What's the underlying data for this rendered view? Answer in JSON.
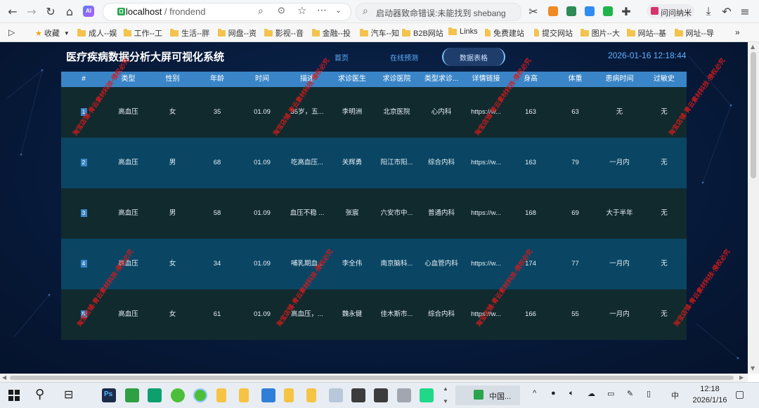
{
  "browser": {
    "address_host": "localhost",
    "address_path": " / frondend",
    "search_text": "启动器致命错误:未能找到 shebang",
    "profile_label": "问问纳米"
  },
  "bookmarks": [
    {
      "label": "收藏",
      "type": "star"
    },
    {
      "label": "成人--娱",
      "type": "folder"
    },
    {
      "label": "工作--工",
      "type": "folder"
    },
    {
      "label": "生活--胖",
      "type": "folder"
    },
    {
      "label": "网盘--资",
      "type": "folder"
    },
    {
      "label": "影视--音",
      "type": "folder"
    },
    {
      "label": "金融--投",
      "type": "folder"
    },
    {
      "label": "汽车--知",
      "type": "folder"
    },
    {
      "label": "B2B网站",
      "type": "folder"
    },
    {
      "label": "Links",
      "type": "folder"
    },
    {
      "label": "免费建站",
      "type": "folder"
    },
    {
      "label": "提交网站",
      "type": "folder"
    },
    {
      "label": "图片--大",
      "type": "folder"
    },
    {
      "label": "网站--基",
      "type": "folder"
    },
    {
      "label": "网址--导",
      "type": "folder"
    }
  ],
  "dashboard": {
    "title": "医疗疾病数据分析大屏可视化系统",
    "tabs": [
      "首页",
      "在线预测",
      "数据表格"
    ],
    "active_tab": "数据表格",
    "datetime": "2026-01-16 12:18:44",
    "watermark": "淘宝店铺-青云素材科技-侵权必究",
    "columns": [
      "#",
      "类型",
      "性别",
      "年龄",
      "时间",
      "描述",
      "求诊医生",
      "求诊医院",
      "类型求诊...",
      "详情链接",
      "身高",
      "体重",
      "患病时间",
      "过敏史"
    ],
    "rows": [
      [
        "1",
        "高血压",
        "女",
        "35",
        "01.09",
        "35岁，五...",
        "李明洲",
        "北京医院",
        "心内科",
        "https://w...",
        "163",
        "63",
        "无",
        "无"
      ],
      [
        "2",
        "高血压",
        "男",
        "68",
        "01.09",
        "吃高血压...",
        "关辉勇",
        "阳江市阳...",
        "综合内科",
        "https://w...",
        "163",
        "79",
        "一月内",
        "无"
      ],
      [
        "3",
        "高血压",
        "男",
        "58",
        "01.09",
        "血压不稳 ...",
        "张宸",
        "六安市中...",
        "普通内科",
        "https://w...",
        "168",
        "69",
        "大于半年",
        "无"
      ],
      [
        "4",
        "高血压",
        "女",
        "34",
        "01.09",
        "哺乳期血...",
        "李全伟",
        "南京脑科...",
        "心血管内科",
        "https://w...",
        "174",
        "77",
        "一月内",
        "无"
      ],
      [
        "5",
        "高血压",
        "女",
        "61",
        "01.09",
        "高血压，...",
        "魏永健",
        "佳木斯市...",
        "综合内科",
        "https://w...",
        "166",
        "55",
        "一月内",
        "无"
      ]
    ]
  },
  "taskbar": {
    "ime_label": "中国...",
    "lang_label": "中",
    "time": "12:18",
    "date": "2026/1/16"
  }
}
